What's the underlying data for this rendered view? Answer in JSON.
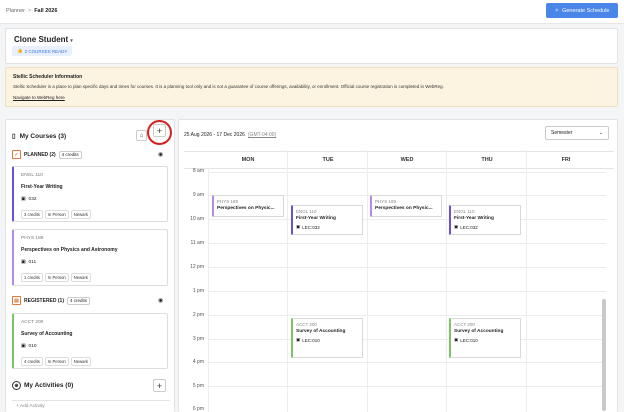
{
  "breadcrumb": {
    "root": "Planner",
    "separator": ">",
    "current": "Fall 2026"
  },
  "header": {
    "generate_label": "Generate Schedule",
    "generate_color": "#4a86e8"
  },
  "student": {
    "name": "Clone Student",
    "caret": "▾",
    "ready_badge": "2 COURSES READY"
  },
  "info": {
    "title": "Stellic Scheduler Information",
    "text": "Stellic Scheduler is a place to plan specific days and times for courses. It is a planning tool only and is not a guarantee of course offerings, availability, or enrollment. Official course registration is completed in WebReg.",
    "link": "Navigate to WebReg here"
  },
  "courses": {
    "title": "My Courses (3)",
    "planned": {
      "label": "PLANNED (2)",
      "credits": "4 credits",
      "color": "#e07a3a"
    },
    "registered": {
      "label": "REGISTERED (1)",
      "credits": "4 credits",
      "color": "#e07a3a"
    },
    "cards": [
      {
        "code": "ENGL 110",
        "title": "First-Year Writing",
        "section": "032",
        "tags": [
          "3 credits",
          "In Person",
          "Newark"
        ],
        "color": "#6a4fd8"
      },
      {
        "code": "PHYS 189",
        "title": "Perspectives on Physics and Astronomy",
        "section": "011",
        "tags": [
          "1 credits",
          "In Person",
          "Newark"
        ],
        "color": "#b48be8"
      },
      {
        "code": "ACCT 200",
        "title": "Survey of Accounting",
        "section": "010",
        "tags": [
          "4 credits",
          "In Person",
          "Newark"
        ],
        "color": "#7cc46a"
      }
    ]
  },
  "activities": {
    "title": "My Activities (0)",
    "add": "+ Add Activity"
  },
  "calendar": {
    "range": "25 Aug 2026 - 17 Dec 2026",
    "timezone": "(GMT-04:00)",
    "view": "Semester",
    "days": [
      "MON",
      "TUE",
      "WED",
      "THU",
      "FRI"
    ],
    "times": [
      "8 am",
      "9 am",
      "10 am",
      "11 am",
      "12 pm",
      "1 pm",
      "2 pm",
      "3 pm",
      "4 pm",
      "5 pm",
      "6 pm"
    ],
    "events": [
      {
        "code": "PHYS 189",
        "title": "Perspectives on Physic...",
        "section": "",
        "color": "#b48be8"
      },
      {
        "code": "ENGL 110",
        "title": "First-Year Writing",
        "section": "LEC:032",
        "color": "#6a4fd8"
      },
      {
        "code": "PHYS 189",
        "title": "Perspectives on Physic...",
        "section": "",
        "color": "#b48be8"
      },
      {
        "code": "ENGL 110",
        "title": "First-Year Writing",
        "section": "LEC:032",
        "color": "#6a4fd8"
      },
      {
        "code": "ACCT 200",
        "title": "Survey of Accounting",
        "section": "LEC:010",
        "color": "#7cc46a"
      },
      {
        "code": "ACCT 200",
        "title": "Survey of Accounting",
        "section": "LEC:010",
        "color": "#7cc46a"
      }
    ]
  }
}
